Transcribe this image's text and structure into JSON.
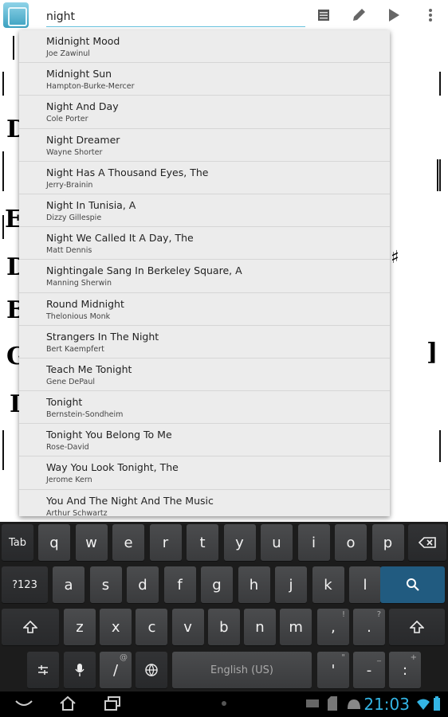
{
  "search": {
    "value": "night"
  },
  "suggestions": [
    {
      "title": "Midnight Mood",
      "composer": "Joe Zawinul"
    },
    {
      "title": "Midnight Sun",
      "composer": "Hampton-Burke-Mercer"
    },
    {
      "title": "Night And Day",
      "composer": "Cole Porter"
    },
    {
      "title": "Night Dreamer",
      "composer": "Wayne Shorter"
    },
    {
      "title": "Night Has A Thousand Eyes, The",
      "composer": "Jerry-Brainin"
    },
    {
      "title": "Night In Tunisia, A",
      "composer": "Dizzy Gillespie"
    },
    {
      "title": "Night We Called It A Day, The",
      "composer": "Matt Dennis"
    },
    {
      "title": "Nightingale Sang In Berkeley Square, A",
      "composer": "Manning Sherwin"
    },
    {
      "title": "Round Midnight",
      "composer": "Thelonious Monk"
    },
    {
      "title": "Strangers In The Night",
      "composer": "Bert Kaempfert"
    },
    {
      "title": "Teach Me Tonight",
      "composer": "Gene DePaul"
    },
    {
      "title": "Tonight",
      "composer": "Bernstein-Sondheim"
    },
    {
      "title": "Tonight You Belong To Me",
      "composer": "Rose-David"
    },
    {
      "title": "Way You Look Tonight, The",
      "composer": "Jerome Kern"
    },
    {
      "title": "You And The Night And The Music",
      "composer": "Arthur Schwartz"
    }
  ],
  "keyboard": {
    "row1": [
      "q",
      "w",
      "e",
      "r",
      "t",
      "y",
      "u",
      "i",
      "o",
      "p"
    ],
    "row2": [
      "a",
      "s",
      "d",
      "f",
      "g",
      "h",
      "j",
      "k",
      "l"
    ],
    "row3": [
      "z",
      "x",
      "c",
      "v",
      "b",
      "n",
      "m"
    ],
    "tab": "Tab",
    "sym": "?123",
    "space": "English (US)",
    "comma": ",",
    "comma_alt": "!",
    "period": ".",
    "period_alt": "?",
    "slash": "/",
    "slash_alt": "@",
    "apostrophe": "'",
    "apostrophe_alt": "\"",
    "dash": "-",
    "dash_alt": "_",
    "colon": ":",
    "colon_alt": "+"
  },
  "status": {
    "time": "21:03"
  },
  "colors": {
    "accent": "#33b5e5",
    "search_key": "#215b80"
  }
}
